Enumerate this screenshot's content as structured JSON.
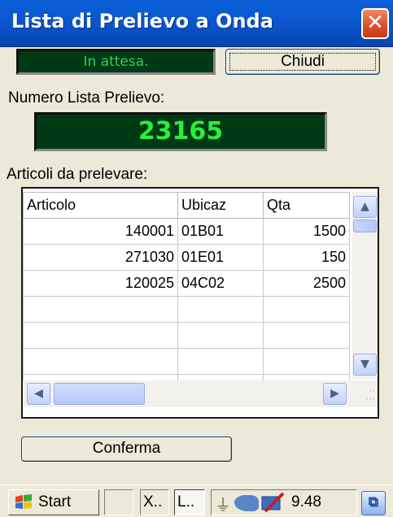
{
  "window": {
    "title": "Lista di Prelievo a Onda",
    "close_icon": "close-icon"
  },
  "status": {
    "text": "In attesa."
  },
  "buttons": {
    "close_label": "Chiudi",
    "confirm_label": "Conferma"
  },
  "labels": {
    "list_number": "Numero Lista Prelievo:",
    "items_to_pick": "Articoli da prelevare:"
  },
  "list_number": {
    "value": "23165"
  },
  "grid": {
    "columns": [
      "Articolo",
      "Ubicaz",
      "Qta"
    ],
    "rows": [
      [
        "140001",
        "01B01",
        "1500"
      ],
      [
        "271030",
        "01E01",
        "150"
      ],
      [
        "120025",
        "04C02",
        "2500"
      ]
    ]
  },
  "taskbar": {
    "start_label": "Start",
    "task_x_label": "X..",
    "task_l_label": "L..",
    "clock": "9.48",
    "icons": [
      "windows-flag-icon",
      "power-plug-icon",
      "network-icon",
      "pen-input-icon",
      "input-method-icon"
    ]
  },
  "colors": {
    "titlebar": "#0b57cf",
    "lcd_background": "#003a14",
    "lcd_text": "#28ef3c",
    "close_button": "#d9532f"
  }
}
